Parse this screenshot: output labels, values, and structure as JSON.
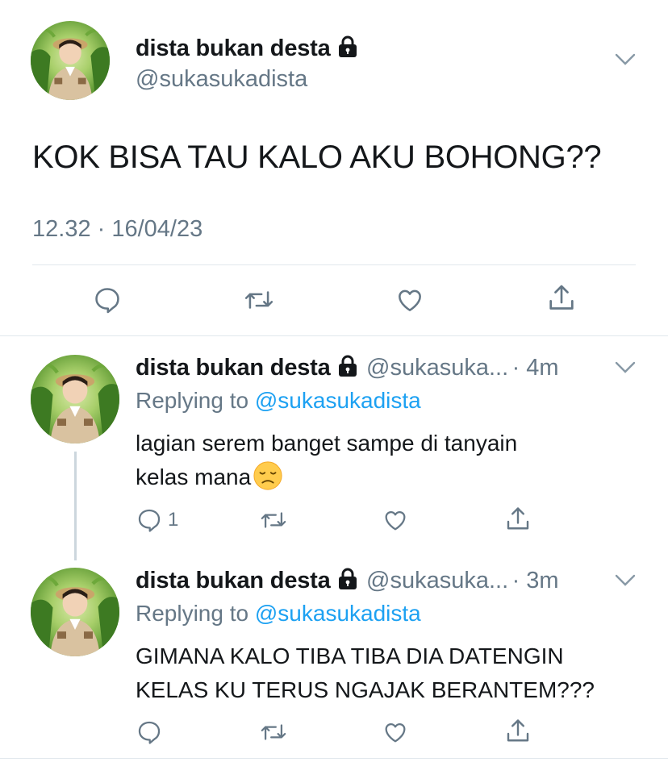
{
  "main_tweet": {
    "display_name": "dista bukan desta",
    "handle": "@sukasukadista",
    "text": "KOK BISA TAU KALO AKU BOHONG??",
    "timestamp": "12.32 · 16/04/23"
  },
  "replies": [
    {
      "display_name": "dista bukan desta",
      "handle": "@sukasuka...",
      "time": "· 4m",
      "replying_prefix": "Replying to",
      "replying_to": "@sukasukadista",
      "text_line1": "lagian serem banget sampe di tanyain",
      "text_line2": "kelas mana",
      "reply_count": "1"
    },
    {
      "display_name": "dista bukan desta",
      "handle": "@sukasuka...",
      "time": "· 3m",
      "replying_prefix": "Replying to",
      "replying_to": "@sukasukadista",
      "text_line1": "GIMANA KALO TIBA TIBA DIA DATENGIN",
      "text_line2": "KELAS KU TERUS NGAJAK BERANTEM???"
    }
  ],
  "icons": {
    "reply": "reply-icon",
    "retweet": "retweet-icon",
    "like": "heart-icon",
    "share": "share-icon",
    "lock": "lock-icon",
    "caret": "chevron-down-icon",
    "emoji": "disappointed-face-emoji"
  },
  "colors": {
    "link": "#1da1f2",
    "secondary_text": "#657786",
    "divider": "#e1e8ed"
  }
}
